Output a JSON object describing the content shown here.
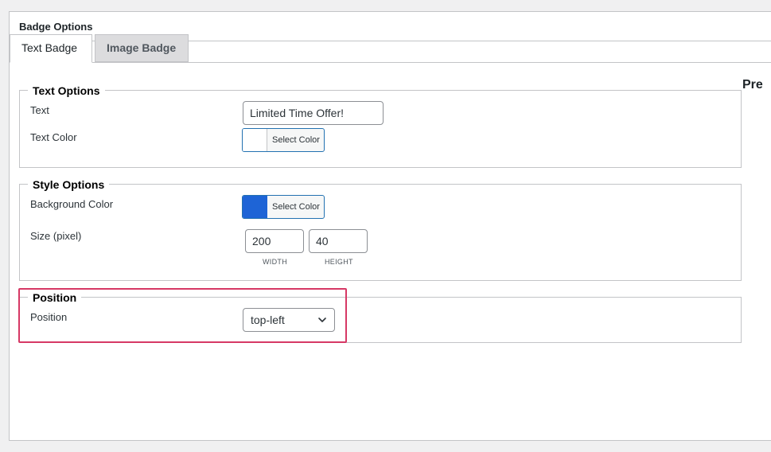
{
  "panel": {
    "title": "Badge Options"
  },
  "tabs": [
    {
      "label": "Text Badge",
      "active": true
    },
    {
      "label": "Image Badge",
      "active": false
    }
  ],
  "preview": {
    "label": "Pre"
  },
  "text_options": {
    "legend": "Text Options",
    "text_label": "Text",
    "text_value": "Limited Time Offer!",
    "text_color_label": "Text Color",
    "text_color_button": "Select Color",
    "text_color_value": "#ffffff"
  },
  "style_options": {
    "legend": "Style Options",
    "bg_color_label": "Background Color",
    "bg_color_button": "Select Color",
    "bg_color_value": "#1e64d6",
    "size_label": "Size (pixel)",
    "width_value": "200",
    "height_value": "40",
    "width_caption": "WIDTH",
    "height_caption": "HEIGHT"
  },
  "position": {
    "legend": "Position",
    "label": "Position",
    "selected": "top-left"
  },
  "colors": {
    "highlight_border": "#d63865",
    "button_border": "#2271b1"
  }
}
